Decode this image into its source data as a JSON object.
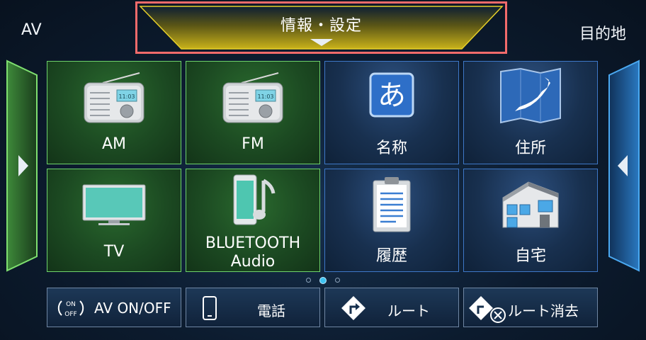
{
  "header": {
    "av_label": "AV",
    "info_title": "情報・設定",
    "destination_label": "目的地"
  },
  "tiles": [
    {
      "label": "AM",
      "icon": "radio-icon",
      "group": "av"
    },
    {
      "label": "FM",
      "icon": "radio-icon",
      "group": "av"
    },
    {
      "label": "名称",
      "icon": "hiragana-a-icon",
      "group": "nav"
    },
    {
      "label": "住所",
      "icon": "japan-map-icon",
      "group": "nav"
    },
    {
      "label": "TV",
      "icon": "tv-icon",
      "group": "av"
    },
    {
      "label_line1": "BLUETOOTH",
      "label_line2": "Audio",
      "icon": "phone-music-icon",
      "group": "av"
    },
    {
      "label": "履歴",
      "icon": "clipboard-icon",
      "group": "nav"
    },
    {
      "label": "自宅",
      "icon": "house-icon",
      "group": "nav"
    }
  ],
  "radio_display": "11:03",
  "pagination": {
    "pages": 3,
    "active": 2
  },
  "bottom_bar": {
    "av_toggle": {
      "label": "AV ON/OFF",
      "icon_on": "ON",
      "icon_off": "OFF"
    },
    "phone": {
      "label": "電話",
      "icon": "phone-icon"
    },
    "route": {
      "label": "ルート",
      "icon": "route-turn-icon"
    },
    "route_delete": {
      "label": "ルート消去",
      "icon": "route-delete-icon"
    }
  },
  "colors": {
    "av_accent": "#6fd36b",
    "nav_accent": "#3e78c8",
    "info_tab_gold": "#c9b21a",
    "highlight_border": "#f26b6b"
  }
}
